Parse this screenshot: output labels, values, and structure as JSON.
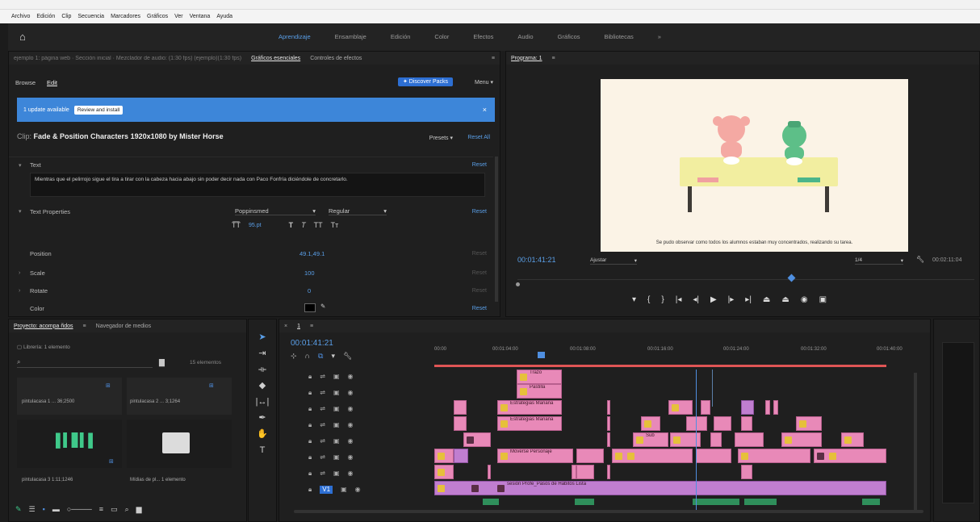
{
  "menubar": {
    "items": [
      "Archivo",
      "Edición",
      "Clip",
      "Secuencia",
      "Marcadores",
      "Gráficos",
      "Ver",
      "Ventana",
      "Ayuda"
    ]
  },
  "workspaces": {
    "tabs": [
      "Aprendizaje",
      "Ensamblaje",
      "Edición",
      "Color",
      "Efectos",
      "Audio",
      "Gráficos",
      "Bibliotecas"
    ],
    "more_icon": "double-chevron-right-icon"
  },
  "essential_graphics": {
    "breadcrumb": "ejemplo 1: página web · Sección inicial · Mezclador de audio: (1:30 fps) (ejemplo)(1:30 fps)",
    "tabs": [
      "Gráficos esenciales",
      "Controles de efectos"
    ],
    "subtabs": [
      "Browse",
      "Edit"
    ],
    "discover_button": "Discover Packs",
    "menu_label": "Menu",
    "update_banner": {
      "text": "1 update available",
      "button": "Review and install"
    },
    "clip_label": "Clip:",
    "clip_name": "Fade & Position Characters 1920x1080 by Mister Horse",
    "presets_label": "Presets",
    "reset_all": "Reset All",
    "text_section": {
      "label": "Text",
      "reset": "Reset",
      "content": "Mientras que el pelirrojo sigue el tira a tirar con la cabeza hacia abajo sin poder decir nada con Paco Fonfría diciéndole de concretarlo."
    },
    "text_properties": {
      "label": "Text Properties",
      "font": "Poppinsmed",
      "weight": "Regular",
      "reset": "Reset",
      "size_value": "95.pt"
    },
    "properties": [
      {
        "label": "Position",
        "value": "49.1,49.1",
        "reset": "Reset"
      },
      {
        "label": "Scale",
        "value": "100",
        "reset": "Reset"
      },
      {
        "label": "Rotate",
        "value": "0",
        "reset": "Reset"
      },
      {
        "label": "Color",
        "value": "",
        "reset": "Reset"
      }
    ]
  },
  "program": {
    "title": "Programa: 1",
    "subtitle": "Se pudo observar como todos los alumnos estaban muy concentrados, realizando su tarea.",
    "timecode": "00:01:41:21",
    "fit_label": "Ajustar",
    "quality": "1/4",
    "duration": "00:02:11:04"
  },
  "project": {
    "tabs": [
      "Proyecto: acompa ñdos",
      "Navegador de medios"
    ],
    "subtitle": "Librería: 1 elemento",
    "count_label": "15 elementos",
    "items": [
      {
        "name": "pintulacasa 1",
        "duration": "36;2500"
      },
      {
        "name": "pintulacasa 2",
        "duration": "3;1264"
      },
      {
        "name": "pintulacasa 3",
        "duration": "1:11;1246"
      },
      {
        "name": "Mídias de pl...",
        "duration": "1 elemento"
      }
    ]
  },
  "timeline": {
    "sequence_name": "1",
    "timecode": "00:01:41:21",
    "ruler": [
      "00:00",
      "00:01:04:00",
      "00:01:08:00",
      "00:01:16:00",
      "00:01:24:00",
      "00:01:32:00",
      "00:01:40:00"
    ],
    "clip_labels": {
      "v8a": "Trazo",
      "v8b": "Pastilla",
      "v7": "Estrategias Mañana",
      "v6": "Estrategias Mañana",
      "v3": "Moverse Personaje",
      "v4": "Sub",
      "a1": "sesión Profe_Pasos de Hábitos Lista"
    }
  },
  "colors": {
    "accent": "#2d6fd3",
    "clip_pink": "#e889b8",
    "clip_violet": "#c07ed0",
    "clip_audio": "#2f8f5b",
    "banner": "#3d86d9"
  }
}
